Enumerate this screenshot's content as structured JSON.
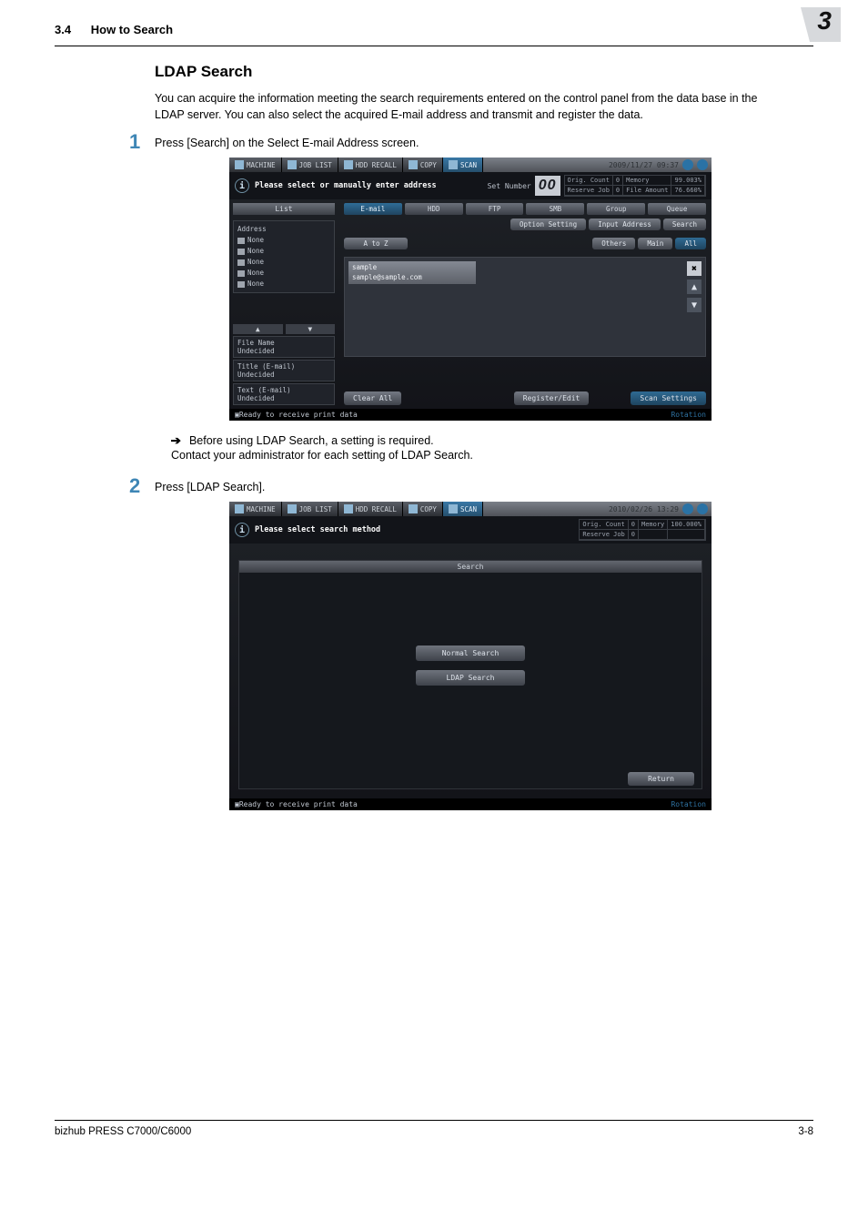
{
  "header": {
    "section": "3.4",
    "title": "How to Search",
    "chapter": "3"
  },
  "section_title": "LDAP Search",
  "intro": "You can acquire the information meeting the search requirements entered on the control panel from the data base in the LDAP server.  You can also select the acquired E-mail address and transmit and register the data.",
  "step1": {
    "num": "1",
    "text": "Press [Search] on the Select E-mail Address screen."
  },
  "note1_lead": "Before using LDAP Search, a setting is required.",
  "note1_follow": "Contact your administrator for each setting of LDAP Search.",
  "step2": {
    "num": "2",
    "text": "Press [LDAP Search]."
  },
  "s1": {
    "tabs": {
      "machine": "MACHINE",
      "joblist": "JOB LIST",
      "hdd": "HDD RECALL",
      "copy": "COPY",
      "scan": "SCAN",
      "ts": "2009/11/27 09:37"
    },
    "info": "Please select or manually enter address",
    "setnum_label": "Set Number",
    "setnum_val": "00",
    "stats": {
      "oc": "Orig. Count",
      "ocv": "0",
      "mem": "Memory",
      "memv": "99.003%",
      "rj": "Reserve Job",
      "rjv": "0",
      "fa": "File Amount",
      "fav": "76.660%"
    },
    "left": {
      "list": "List",
      "addr_head": "Address",
      "rows": [
        "None",
        "None",
        "None",
        "None",
        "None"
      ],
      "filename": "File Name",
      "filename_v": "Undecided",
      "title": "Title (E-mail)",
      "title_v": "Undecided",
      "text": "Text (E-mail)",
      "text_v": "Undecided"
    },
    "proto": [
      "E-mail",
      "HDD",
      "FTP",
      "SMB",
      "Group",
      "Queue"
    ],
    "row2": [
      "Option Setting",
      "Input Address",
      "Search"
    ],
    "row3": [
      "A to Z",
      "Others",
      "Main",
      "All"
    ],
    "card_name": "sample",
    "card_mail": "sample@sample.com",
    "footer": {
      "clear": "Clear All",
      "reg": "Register/Edit",
      "scan": "Scan Settings"
    },
    "status": "Ready to receive print data",
    "rotation": "Rotation"
  },
  "s2": {
    "tabs": {
      "machine": "MACHINE",
      "joblist": "JOB LIST",
      "hdd": "HDD RECALL",
      "copy": "COPY",
      "scan": "SCAN",
      "ts": "2010/02/26 13:29"
    },
    "info": "Please select search method",
    "stats": {
      "oc": "Orig. Count",
      "ocv": "0",
      "mem": "Memory",
      "memv": "100.000%",
      "rj": "Reserve Job",
      "rjv": "0"
    },
    "search_label": "Search",
    "normal": "Normal Search",
    "ldap": "LDAP Search",
    "ret": "Return",
    "status": "Ready to receive print data",
    "rotation": "Rotation"
  },
  "footer": {
    "product": "bizhub PRESS C7000/C6000",
    "page": "3-8"
  }
}
